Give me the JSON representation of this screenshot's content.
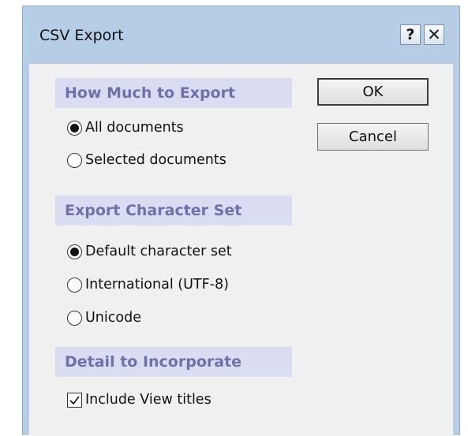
{
  "window": {
    "title": "CSV Export",
    "help_label": "?",
    "close_label": "✕"
  },
  "groups": {
    "how_much": {
      "header": "How Much to Export",
      "options": [
        {
          "label": "All documents",
          "checked": true
        },
        {
          "label": "Selected documents",
          "checked": false
        }
      ]
    },
    "charset": {
      "header": "Export Character Set",
      "options": [
        {
          "label": "Default character set",
          "checked": true
        },
        {
          "label": "International (UTF-8)",
          "checked": false
        },
        {
          "label": "Unicode",
          "checked": false
        }
      ]
    },
    "detail": {
      "header": "Detail to Incorporate",
      "options": [
        {
          "label": "Include View titles",
          "checked": true
        }
      ]
    }
  },
  "buttons": {
    "ok_label": "OK",
    "cancel_label": "Cancel"
  },
  "colors": {
    "frame": "#b5cde5",
    "client": "#f0f0f0",
    "group_header_bg": "#dadcf2",
    "group_header_text": "#6e72aa"
  }
}
